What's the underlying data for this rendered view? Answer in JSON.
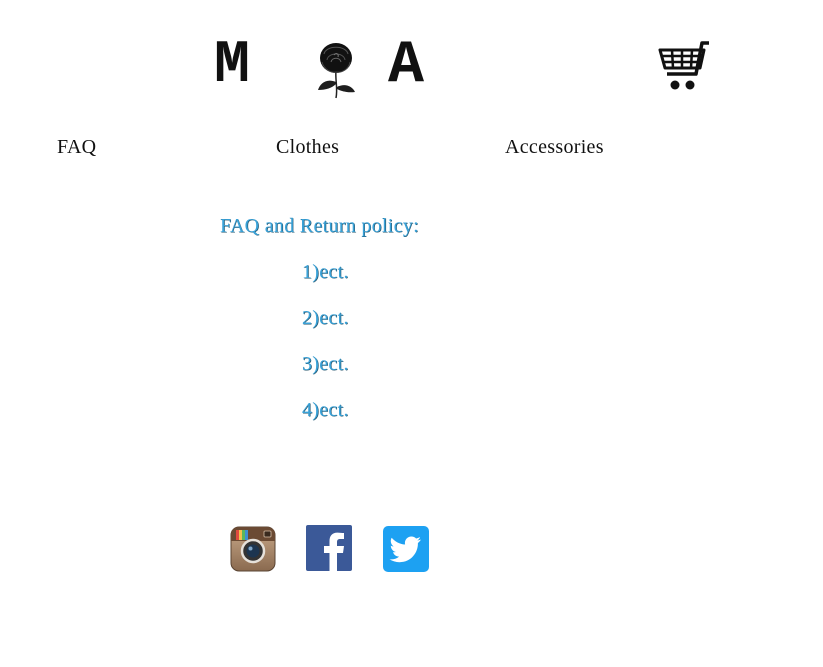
{
  "logo": {
    "letter_left": "M",
    "letter_right": "A",
    "emblem": "rose-icon"
  },
  "header": {
    "cart_icon": "shopping-cart-icon"
  },
  "nav": {
    "items": [
      {
        "label": "FAQ"
      },
      {
        "label": "Clothes"
      },
      {
        "label": "Accessories"
      }
    ]
  },
  "content": {
    "heading": "FAQ and Return policy:",
    "items": [
      "1)ect.",
      "2)ect.",
      "3)ect.",
      "4)ect."
    ],
    "text_color": "#3aa2d8"
  },
  "social": {
    "icons": [
      "instagram-icon",
      "facebook-icon",
      "twitter-icon"
    ],
    "colors": {
      "facebook": "#3b5998",
      "twitter": "#1da1f2"
    }
  }
}
